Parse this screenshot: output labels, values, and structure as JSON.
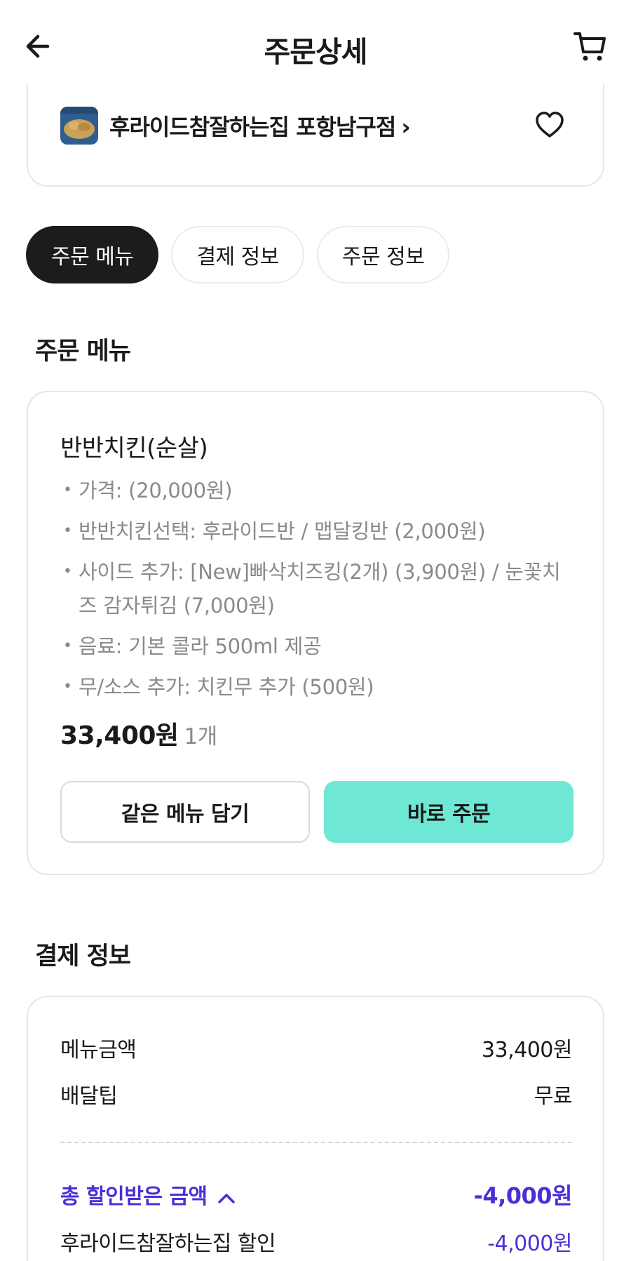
{
  "header": {
    "title": "주문상세",
    "back_icon": "arrow-left-icon",
    "cart_icon": "cart-icon"
  },
  "store": {
    "name": "후라이드참잘하는집 포항남구점",
    "chevron": "›",
    "favorite_icon": "heart-icon"
  },
  "tabs": [
    {
      "label": "주문 메뉴",
      "active": true
    },
    {
      "label": "결제 정보",
      "active": false
    },
    {
      "label": "주문 정보",
      "active": false
    }
  ],
  "order_menu": {
    "section_title": "주문 메뉴",
    "item": {
      "name": "반반치킨(순살)",
      "options": [
        "가격:  (20,000원)",
        "반반치킨선택: 후라이드반  / 맵달킹반 (2,000원)",
        "사이드 추가: [New]빠삭치즈킹(2개) (3,900원) / 눈꽃치즈 감자튀김 (7,000원)",
        "음료: 기본 콜라 500ml 제공",
        "무/소스 추가: 치킨무 추가 (500원)"
      ],
      "price": "33,400원",
      "quantity": "1개"
    },
    "buttons": {
      "add_same": "같은 메뉴 담기",
      "order_now": "바로 주문"
    }
  },
  "payment": {
    "section_title": "결제 정보",
    "rows": [
      {
        "label": "메뉴금액",
        "value": "33,400원"
      },
      {
        "label": "배달팁",
        "value": "무료"
      }
    ],
    "discount_total": {
      "label": "총 할인받은 금액",
      "value": "-4,000원"
    },
    "discount_items": [
      {
        "label": "후라이드참잘하는집 할인",
        "value": "-4,000원"
      }
    ]
  },
  "colors": {
    "accent_mint": "#6ee8d4",
    "discount_purple": "#4b2fd6",
    "active_tab": "#1c1c1e"
  }
}
